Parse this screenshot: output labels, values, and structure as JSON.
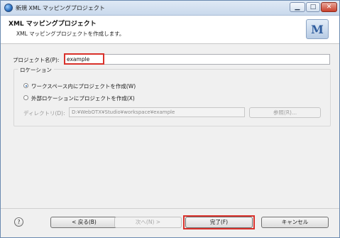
{
  "window": {
    "title": "新規 XML マッピングプロジェクト",
    "controls": {
      "minimize": "▁",
      "maximize": "□",
      "close": "✕"
    }
  },
  "banner": {
    "title": "XML マッピングプロジェクト",
    "description": "XML マッピングプロジェクトを作成します。",
    "logo_letter": "M"
  },
  "form": {
    "project_name_label": "プロジェクト名(P):",
    "project_name_value": "example",
    "location": {
      "legend": "ロケーション",
      "options": [
        {
          "label": "ワークスペース内にプロジェクトを作成(W)",
          "selected": true
        },
        {
          "label": "外部ロケーションにプロジェクトを作成(X)",
          "selected": false
        }
      ],
      "directory_label": "ディレクトリ(D):",
      "directory_value": "D:¥WebOTX¥Studio¥workspace¥example",
      "browse_label": "参照(R)..."
    }
  },
  "footer": {
    "help_label": "?",
    "back_label": "< 戻る(B)",
    "next_label": "次へ(N) >",
    "finish_label": "完了(F)",
    "cancel_label": "キャンセル"
  },
  "colors": {
    "highlight": "#d9312b",
    "title_bar": "#c9d9ec"
  }
}
